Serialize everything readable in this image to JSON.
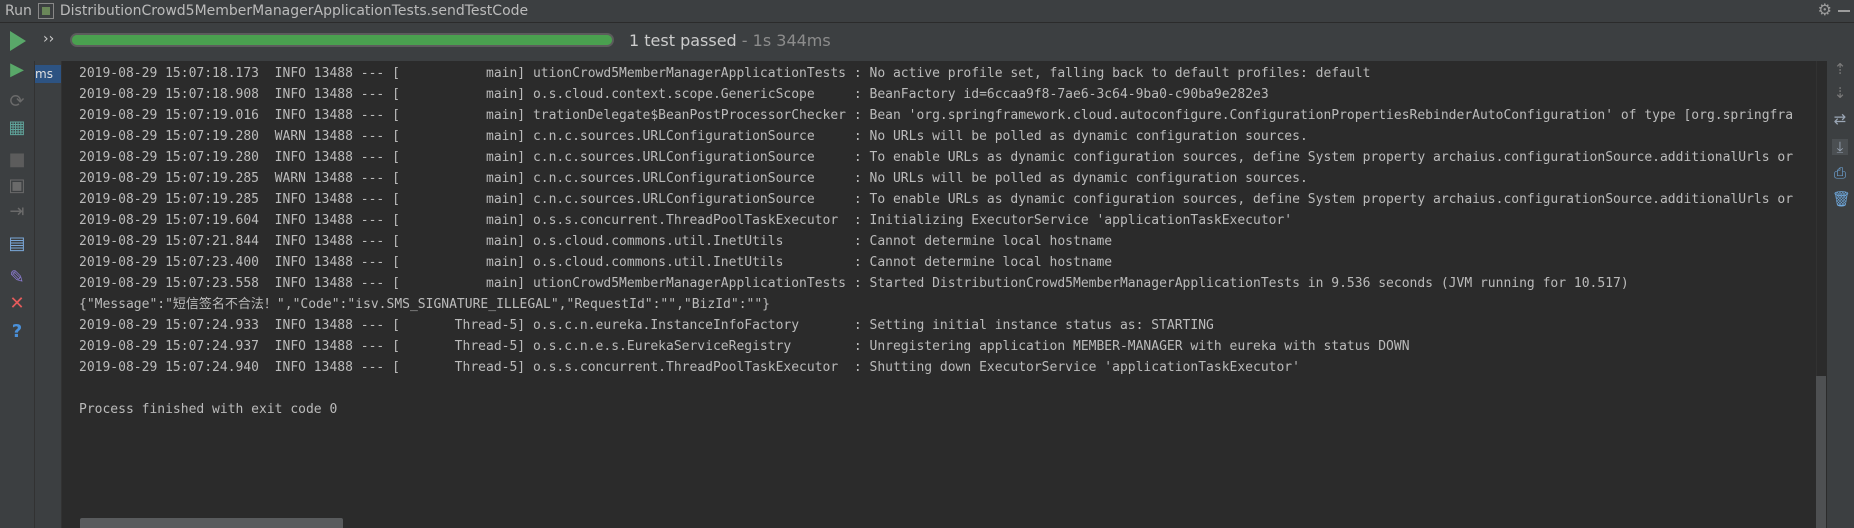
{
  "titlebar": {
    "run_label": "Run",
    "tab_title": "DistributionCrowd5MemberManagerApplicationTests.sendTestCode"
  },
  "topbar": {
    "progress_fraction": 1.0,
    "status_text": "1 test passed",
    "status_time": " - 1s 344ms"
  },
  "tree": {
    "selected_label": "ms"
  },
  "console": {
    "lines": [
      "2019-08-29 15:07:18.173  INFO 13488 --- [           main] utionCrowd5MemberManagerApplicationTests : No active profile set, falling back to default profiles: default",
      "2019-08-29 15:07:18.908  INFO 13488 --- [           main] o.s.cloud.context.scope.GenericScope     : BeanFactory id=6ccaa9f8-7ae6-3c64-9ba0-c90ba9e282e3",
      "2019-08-29 15:07:19.016  INFO 13488 --- [           main] trationDelegate$BeanPostProcessorChecker : Bean 'org.springframework.cloud.autoconfigure.ConfigurationPropertiesRebinderAutoConfiguration' of type [org.springfra",
      "2019-08-29 15:07:19.280  WARN 13488 --- [           main] c.n.c.sources.URLConfigurationSource     : No URLs will be polled as dynamic configuration sources.",
      "2019-08-29 15:07:19.280  INFO 13488 --- [           main] c.n.c.sources.URLConfigurationSource     : To enable URLs as dynamic configuration sources, define System property archaius.configurationSource.additionalUrls or",
      "2019-08-29 15:07:19.285  WARN 13488 --- [           main] c.n.c.sources.URLConfigurationSource     : No URLs will be polled as dynamic configuration sources.",
      "2019-08-29 15:07:19.285  INFO 13488 --- [           main] c.n.c.sources.URLConfigurationSource     : To enable URLs as dynamic configuration sources, define System property archaius.configurationSource.additionalUrls or",
      "2019-08-29 15:07:19.604  INFO 13488 --- [           main] o.s.s.concurrent.ThreadPoolTaskExecutor  : Initializing ExecutorService 'applicationTaskExecutor'",
      "2019-08-29 15:07:21.844  INFO 13488 --- [           main] o.s.cloud.commons.util.InetUtils         : Cannot determine local hostname",
      "2019-08-29 15:07:23.400  INFO 13488 --- [           main] o.s.cloud.commons.util.InetUtils         : Cannot determine local hostname",
      "2019-08-29 15:07:23.558  INFO 13488 --- [           main] utionCrowd5MemberManagerApplicationTests : Started DistributionCrowd5MemberManagerApplicationTests in 9.536 seconds (JVM running for 10.517)",
      "{\"Message\":\"短信签名不合法！\",\"Code\":\"isv.SMS_SIGNATURE_ILLEGAL\",\"RequestId\":\"\",\"BizId\":\"\"}",
      "2019-08-29 15:07:24.933  INFO 13488 --- [       Thread-5] o.s.c.n.eureka.InstanceInfoFactory       : Setting initial instance status as: STARTING",
      "2019-08-29 15:07:24.937  INFO 13488 --- [       Thread-5] o.s.c.n.e.s.EurekaServiceRegistry        : Unregistering application MEMBER-MANAGER with eureka with status DOWN",
      "2019-08-29 15:07:24.940  INFO 13488 --- [       Thread-5] o.s.s.concurrent.ThreadPoolTaskExecutor  : Shutting down ExecutorService 'applicationTaskExecutor'",
      "",
      "Process finished with exit code 0"
    ]
  },
  "colors": {
    "accent_green": "#499c54",
    "background": "#2b2b2b",
    "panel": "#3c3f41"
  },
  "icons": {
    "left": [
      "play-icon",
      "rerun-failed-icon",
      "toggle-tests-icon",
      "stop-icon",
      "screenshot-icon",
      "exit-icon",
      "layout-icon",
      "pin-icon",
      "close-icon",
      "help-icon"
    ],
    "right": [
      "up-arrow-icon",
      "down-arrow-icon",
      "soft-wrap-icon",
      "scroll-to-end-icon",
      "print-icon",
      "clear-icon"
    ]
  }
}
